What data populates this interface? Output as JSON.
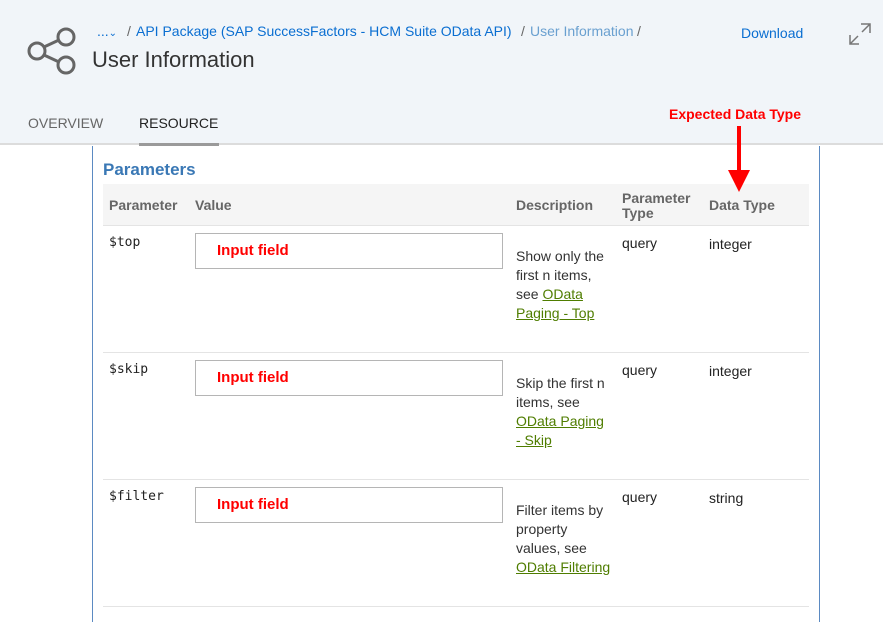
{
  "header": {
    "breadcrumb": {
      "overflow": "...",
      "package": "API Package (SAP SuccessFactors - HCM Suite OData API)",
      "current": "User Information",
      "separator": "/"
    },
    "title": "User Information",
    "download_label": "Download"
  },
  "tabs": [
    {
      "label": "OVERVIEW",
      "active": false
    },
    {
      "label": "RESOURCE",
      "active": true
    }
  ],
  "section_title": "Parameters",
  "table": {
    "columns": [
      "Parameter",
      "Value",
      "Description",
      "Parameter Type",
      "Data Type"
    ],
    "rows": [
      {
        "name": "$top",
        "value": "Input field",
        "desc": "Show only the first n items, see",
        "link": "OData Paging - Top",
        "ptype": "query",
        "dtype": "integer"
      },
      {
        "name": "$skip",
        "value": "Input field",
        "desc": "Skip the first n items, see",
        "link": "OData Paging - Skip",
        "ptype": "query",
        "dtype": "integer"
      },
      {
        "name": "$filter",
        "value": "Input field",
        "desc": "Filter items by property values, see",
        "link": "OData Filtering",
        "ptype": "query",
        "dtype": "string"
      }
    ]
  },
  "annotation": {
    "label": "Expected Data Type",
    "color": "#ff0000"
  }
}
